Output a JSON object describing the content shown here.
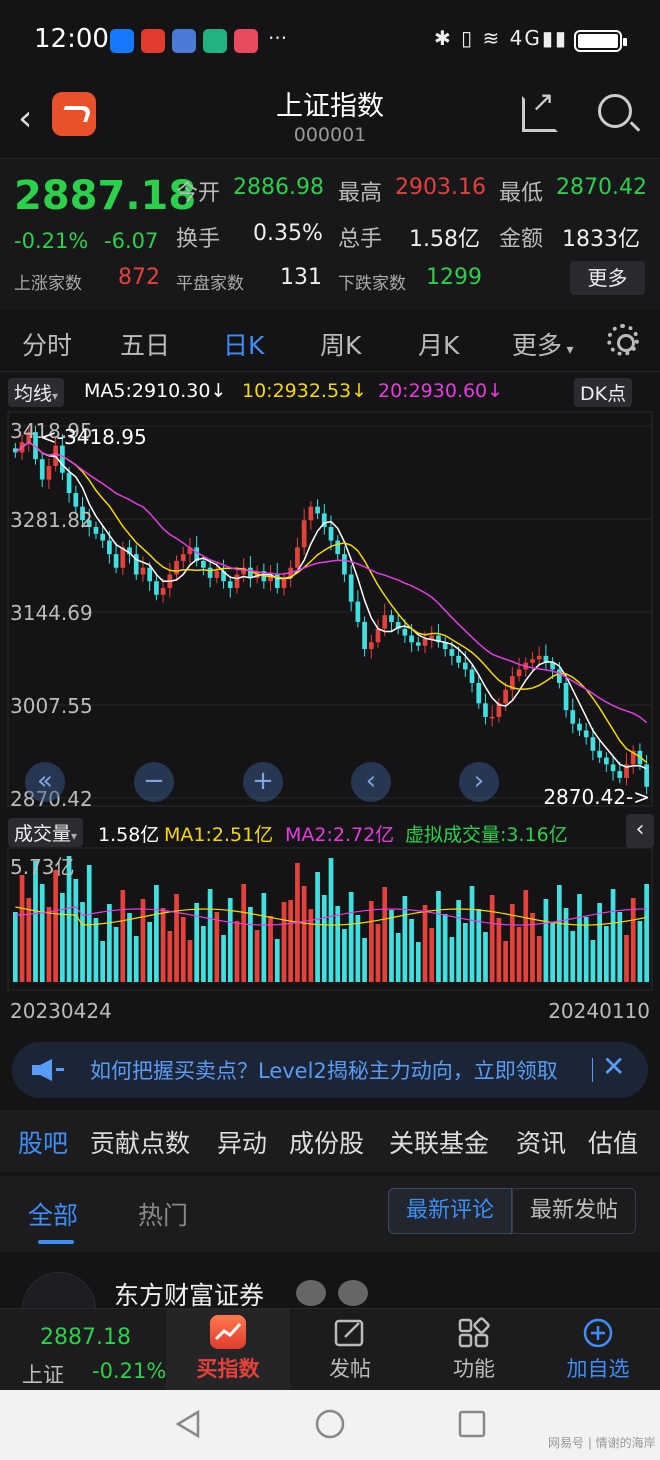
{
  "status_bar": {
    "time": "12:00",
    "more": "···",
    "signal_text": "4G"
  },
  "header": {
    "title": "上证指数",
    "code": "000001"
  },
  "quote": {
    "price": "2887.18",
    "change_pct": "-0.21%",
    "change_abs": "-6.07",
    "open_label": "今开",
    "open_value": "2886.98",
    "high_label": "最高",
    "high_value": "2903.16",
    "low_label": "最低",
    "low_value": "2870.42",
    "turnover_label": "换手",
    "turnover_value": "0.35%",
    "volume_label": "总手",
    "volume_value": "1.58亿",
    "amount_label": "金额",
    "amount_value": "1833亿",
    "up_label": "上涨家数",
    "up_value": "872",
    "flat_label": "平盘家数",
    "flat_value": "131",
    "down_label": "下跌家数",
    "down_value": "1299",
    "more_label": "更多"
  },
  "ktabs": [
    "分时",
    "五日",
    "日K",
    "周K",
    "月K",
    "更多"
  ],
  "active_ktab": "日K",
  "ma_bar": {
    "selector": "均线",
    "ma5": "MA5:2910.30↓",
    "ma10": "10:2932.53↓",
    "ma20": "20:2930.60↓",
    "dk": "DK点"
  },
  "volume_bar": {
    "selector": "成交量",
    "vol": "1.58亿",
    "ma1": "MA1:2.51亿",
    "ma2": "MA2:2.72亿",
    "virtual": "虚拟成交量:3.16亿"
  },
  "chart_data": {
    "type": "candlestick",
    "y_ticks": [
      "3418.95",
      "3281.82",
      "3144.69",
      "3007.55",
      "2870.42"
    ],
    "max_marker": "<-3418.95",
    "min_marker": "2870.42->",
    "vol_tick": "5.73亿",
    "x_start": "20230424",
    "x_end": "20240110",
    "ylim": [
      2870.42,
      3418.95
    ],
    "series_close": [
      3380,
      3395,
      3410,
      3370,
      3340,
      3360,
      3390,
      3350,
      3320,
      3300,
      3280,
      3270,
      3260,
      3250,
      3230,
      3210,
      3240,
      3230,
      3200,
      3210,
      3190,
      3170,
      3180,
      3200,
      3220,
      3230,
      3240,
      3220,
      3210,
      3195,
      3205,
      3190,
      3180,
      3200,
      3210,
      3195,
      3205,
      3190,
      3200,
      3180,
      3195,
      3210,
      3240,
      3280,
      3300,
      3290,
      3270,
      3250,
      3230,
      3200,
      3160,
      3130,
      3090,
      3100,
      3120,
      3140,
      3130,
      3120,
      3110,
      3100,
      3095,
      3105,
      3110,
      3100,
      3090,
      3080,
      3070,
      3060,
      3040,
      3010,
      2990,
      2990,
      3010,
      3030,
      3050,
      3060,
      3070,
      3075,
      3080,
      3070,
      3060,
      3040,
      3000,
      2980,
      2970,
      2960,
      2940,
      2930,
      2920,
      2910,
      2900,
      2920,
      2940,
      2920,
      2887
    ]
  },
  "nav_buttons": [
    "«",
    "−",
    "+",
    "‹",
    "›",
    "‹"
  ],
  "ad": {
    "text": "如何把握买卖点？Level2揭秘主力动向，立即领取"
  },
  "section_tabs": [
    "股吧",
    "贡献点数",
    "异动",
    "成份股",
    "关联基金",
    "资讯",
    "估值"
  ],
  "sub_tabs": [
    "全部",
    "热门"
  ],
  "sort_buttons": [
    "最新评论",
    "最新发帖"
  ],
  "post": {
    "author": "东方财富证券"
  },
  "bottom_bar": {
    "index_price": "2887.18",
    "index_name": "上证",
    "index_change": "-0.21%",
    "buy_label": "买指数",
    "post_label": "发帖",
    "func_label": "功能",
    "add_label": "加自选"
  },
  "watermark": "网易号 | 情谢的海岸",
  "colors": {
    "up": "#e5413b",
    "down": "#2bd14a",
    "accent": "#3d8ef7",
    "ma5": "#ffffff",
    "ma10": "#f5d800",
    "ma20": "#e63ce0",
    "bar_down": "#3fe0e0"
  }
}
